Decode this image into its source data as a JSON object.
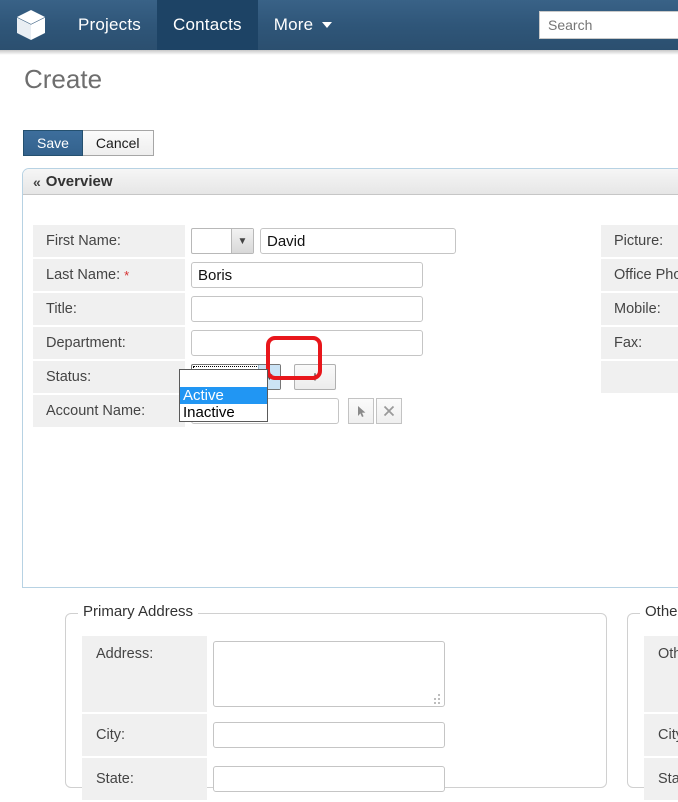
{
  "navbar": {
    "logo_icon": "cube-logo-icon",
    "items": [
      {
        "label": "Projects",
        "active": false
      },
      {
        "label": "Contacts",
        "active": true
      },
      {
        "label": "More",
        "active": false,
        "caret": true
      }
    ],
    "search": {
      "placeholder": "Search",
      "value": ""
    }
  },
  "page": {
    "title": "Create"
  },
  "toolbar": {
    "save_label": "Save",
    "cancel_label": "Cancel"
  },
  "panel": {
    "title": "Overview",
    "collapse_icon": "chevron-double-up-icon"
  },
  "form": {
    "rows": [
      {
        "label": "First Name:",
        "required": false
      },
      {
        "label": "Last Name:",
        "required": true
      },
      {
        "label": "Title:",
        "required": false
      },
      {
        "label": "Department:",
        "required": false
      },
      {
        "label": "Status:",
        "required": false
      },
      {
        "label": "Account Name:",
        "required": false
      }
    ],
    "first_name": {
      "salutation": "",
      "value": "",
      "text_value": "David"
    },
    "last_name": {
      "value": "Boris"
    },
    "title": {
      "value": ""
    },
    "department": {
      "value": ""
    },
    "status": {
      "value": "",
      "add_button_label": "+",
      "options": [
        "",
        "Active",
        "Inactive"
      ],
      "highlighted_option": "Active",
      "open": true
    },
    "account_name": {
      "value": "",
      "select_icon": "cursor-arrow-icon",
      "clear_icon": "close-x-icon"
    }
  },
  "right_column": {
    "labels": [
      "Picture:",
      "Office Phone:",
      "Mobile:",
      "Fax:"
    ]
  },
  "primary_address": {
    "legend": "Primary Address",
    "rows": [
      {
        "label": "Address:",
        "value": ""
      },
      {
        "label": "City:",
        "value": ""
      },
      {
        "label": "State:",
        "value": ""
      }
    ]
  },
  "other_address": {
    "legend": "Other Address",
    "rows": [
      {
        "label": "Other Address:",
        "value": ""
      },
      {
        "label": "City:",
        "value": ""
      },
      {
        "label": "State:",
        "value": ""
      }
    ]
  },
  "colors": {
    "navbar": "#2f5679",
    "navbar_active": "#1d4365",
    "primary_button": "#33628d",
    "highlight_red": "#e8161b",
    "option_selected": "#2196f3",
    "required_asterisk": "#d62f2f",
    "label_cell": "#f0f0f0"
  }
}
